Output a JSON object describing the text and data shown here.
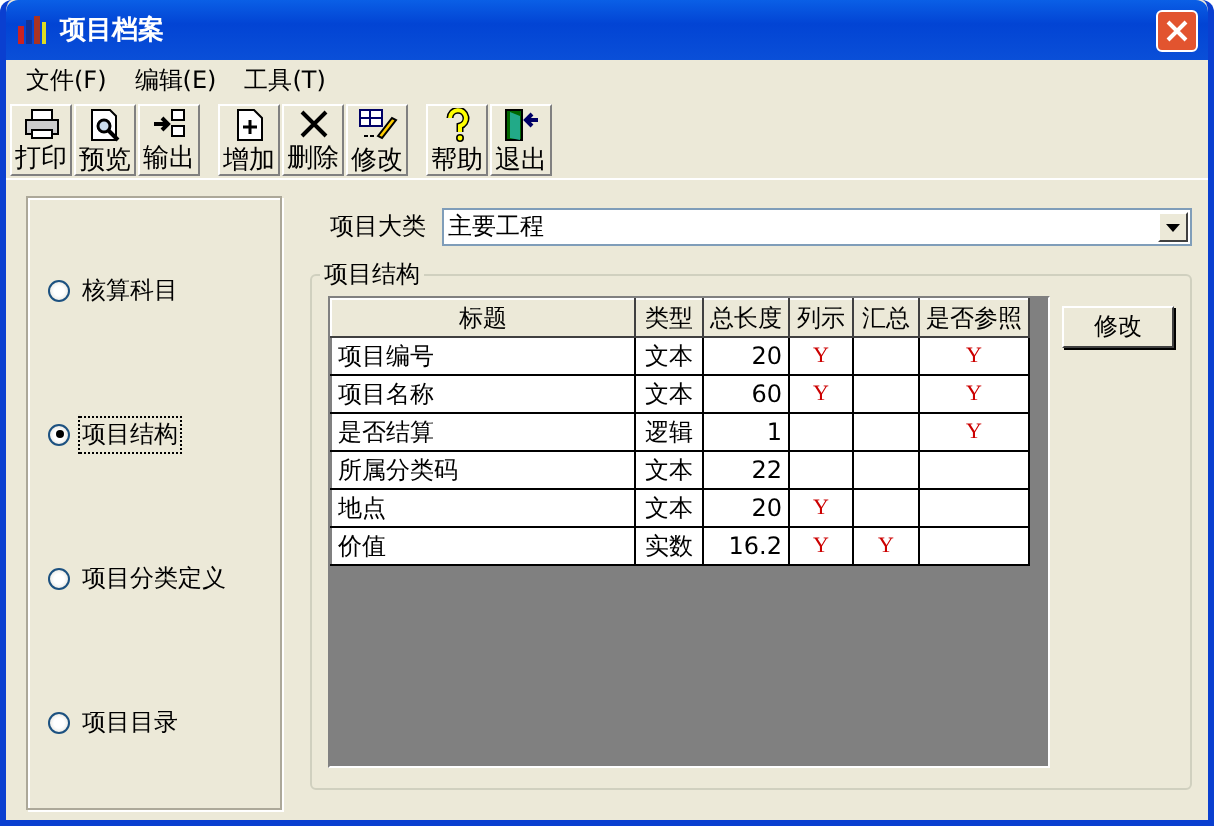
{
  "window": {
    "title": "项目档案"
  },
  "menu": [
    {
      "label": "文件(F)"
    },
    {
      "label": "编辑(E)"
    },
    {
      "label": "工具(T)"
    }
  ],
  "toolbar": [
    [
      {
        "label": "打印",
        "kind": "printer"
      },
      {
        "label": "预览",
        "kind": "preview"
      },
      {
        "label": "输出",
        "kind": "export"
      }
    ],
    [
      {
        "label": "增加",
        "kind": "add"
      },
      {
        "label": "删除",
        "kind": "delete"
      },
      {
        "label": "修改",
        "kind": "edit"
      }
    ],
    [
      {
        "label": "帮助",
        "kind": "help"
      },
      {
        "label": "退出",
        "kind": "exit"
      }
    ]
  ],
  "sections": [
    {
      "label": "核算科目",
      "selected": false
    },
    {
      "label": "项目结构",
      "selected": true
    },
    {
      "label": "项目分类定义",
      "selected": false
    },
    {
      "label": "项目目录",
      "selected": false
    }
  ],
  "category": {
    "label": "项目大类",
    "value": "主要工程"
  },
  "structure": {
    "title": "项目结构",
    "edit_button": "修改",
    "columns": [
      "标题",
      "类型",
      "总长度",
      "列示",
      "汇总",
      "是否参照"
    ],
    "rows": [
      {
        "title": "项目编号",
        "type": "文本",
        "length": "20",
        "listed": "Y",
        "reference": "Y"
      },
      {
        "title": "项目名称",
        "type": "文本",
        "length": "60",
        "listed": "Y",
        "reference": "Y"
      },
      {
        "title": "是否结算",
        "type": "逻辑",
        "length": "1",
        "reference": "Y"
      },
      {
        "title": "所属分类码",
        "type": "文本",
        "length": "22"
      },
      {
        "title": "地点",
        "type": "文本",
        "length": "20",
        "listed": "Y"
      },
      {
        "title": "价值",
        "type": "实数",
        "length": "16.2",
        "listed": "Y",
        "summary": "Y"
      }
    ]
  }
}
